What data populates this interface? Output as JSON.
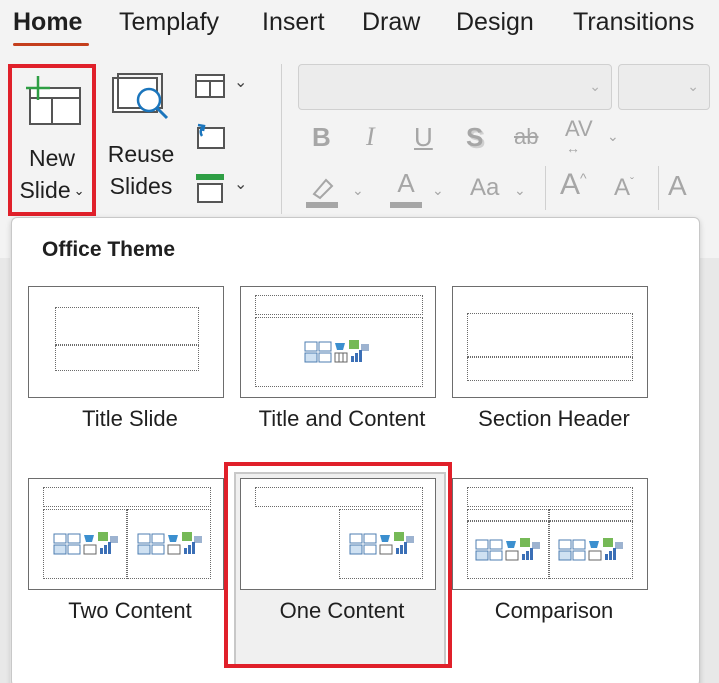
{
  "tabs": [
    "Home",
    "Templafy",
    "Insert",
    "Draw",
    "Design",
    "Transitions"
  ],
  "ribbon": {
    "new_slide_line1": "New",
    "new_slide_line2": "Slide",
    "reuse_line1": "Reuse",
    "reuse_line2": "Slides"
  },
  "gallery": {
    "title": "Office Theme",
    "layouts": [
      {
        "label": "Title Slide"
      },
      {
        "label": "Title and Content"
      },
      {
        "label": "Section Header"
      },
      {
        "label": "Two Content"
      },
      {
        "label": "One Content"
      },
      {
        "label": "Comparison"
      }
    ],
    "selected_layout": "One Content"
  },
  "colors": {
    "accent_tab": "#c43e1c",
    "highlight_red": "#e0202a",
    "new_slide_plus": "#2e9e44"
  }
}
